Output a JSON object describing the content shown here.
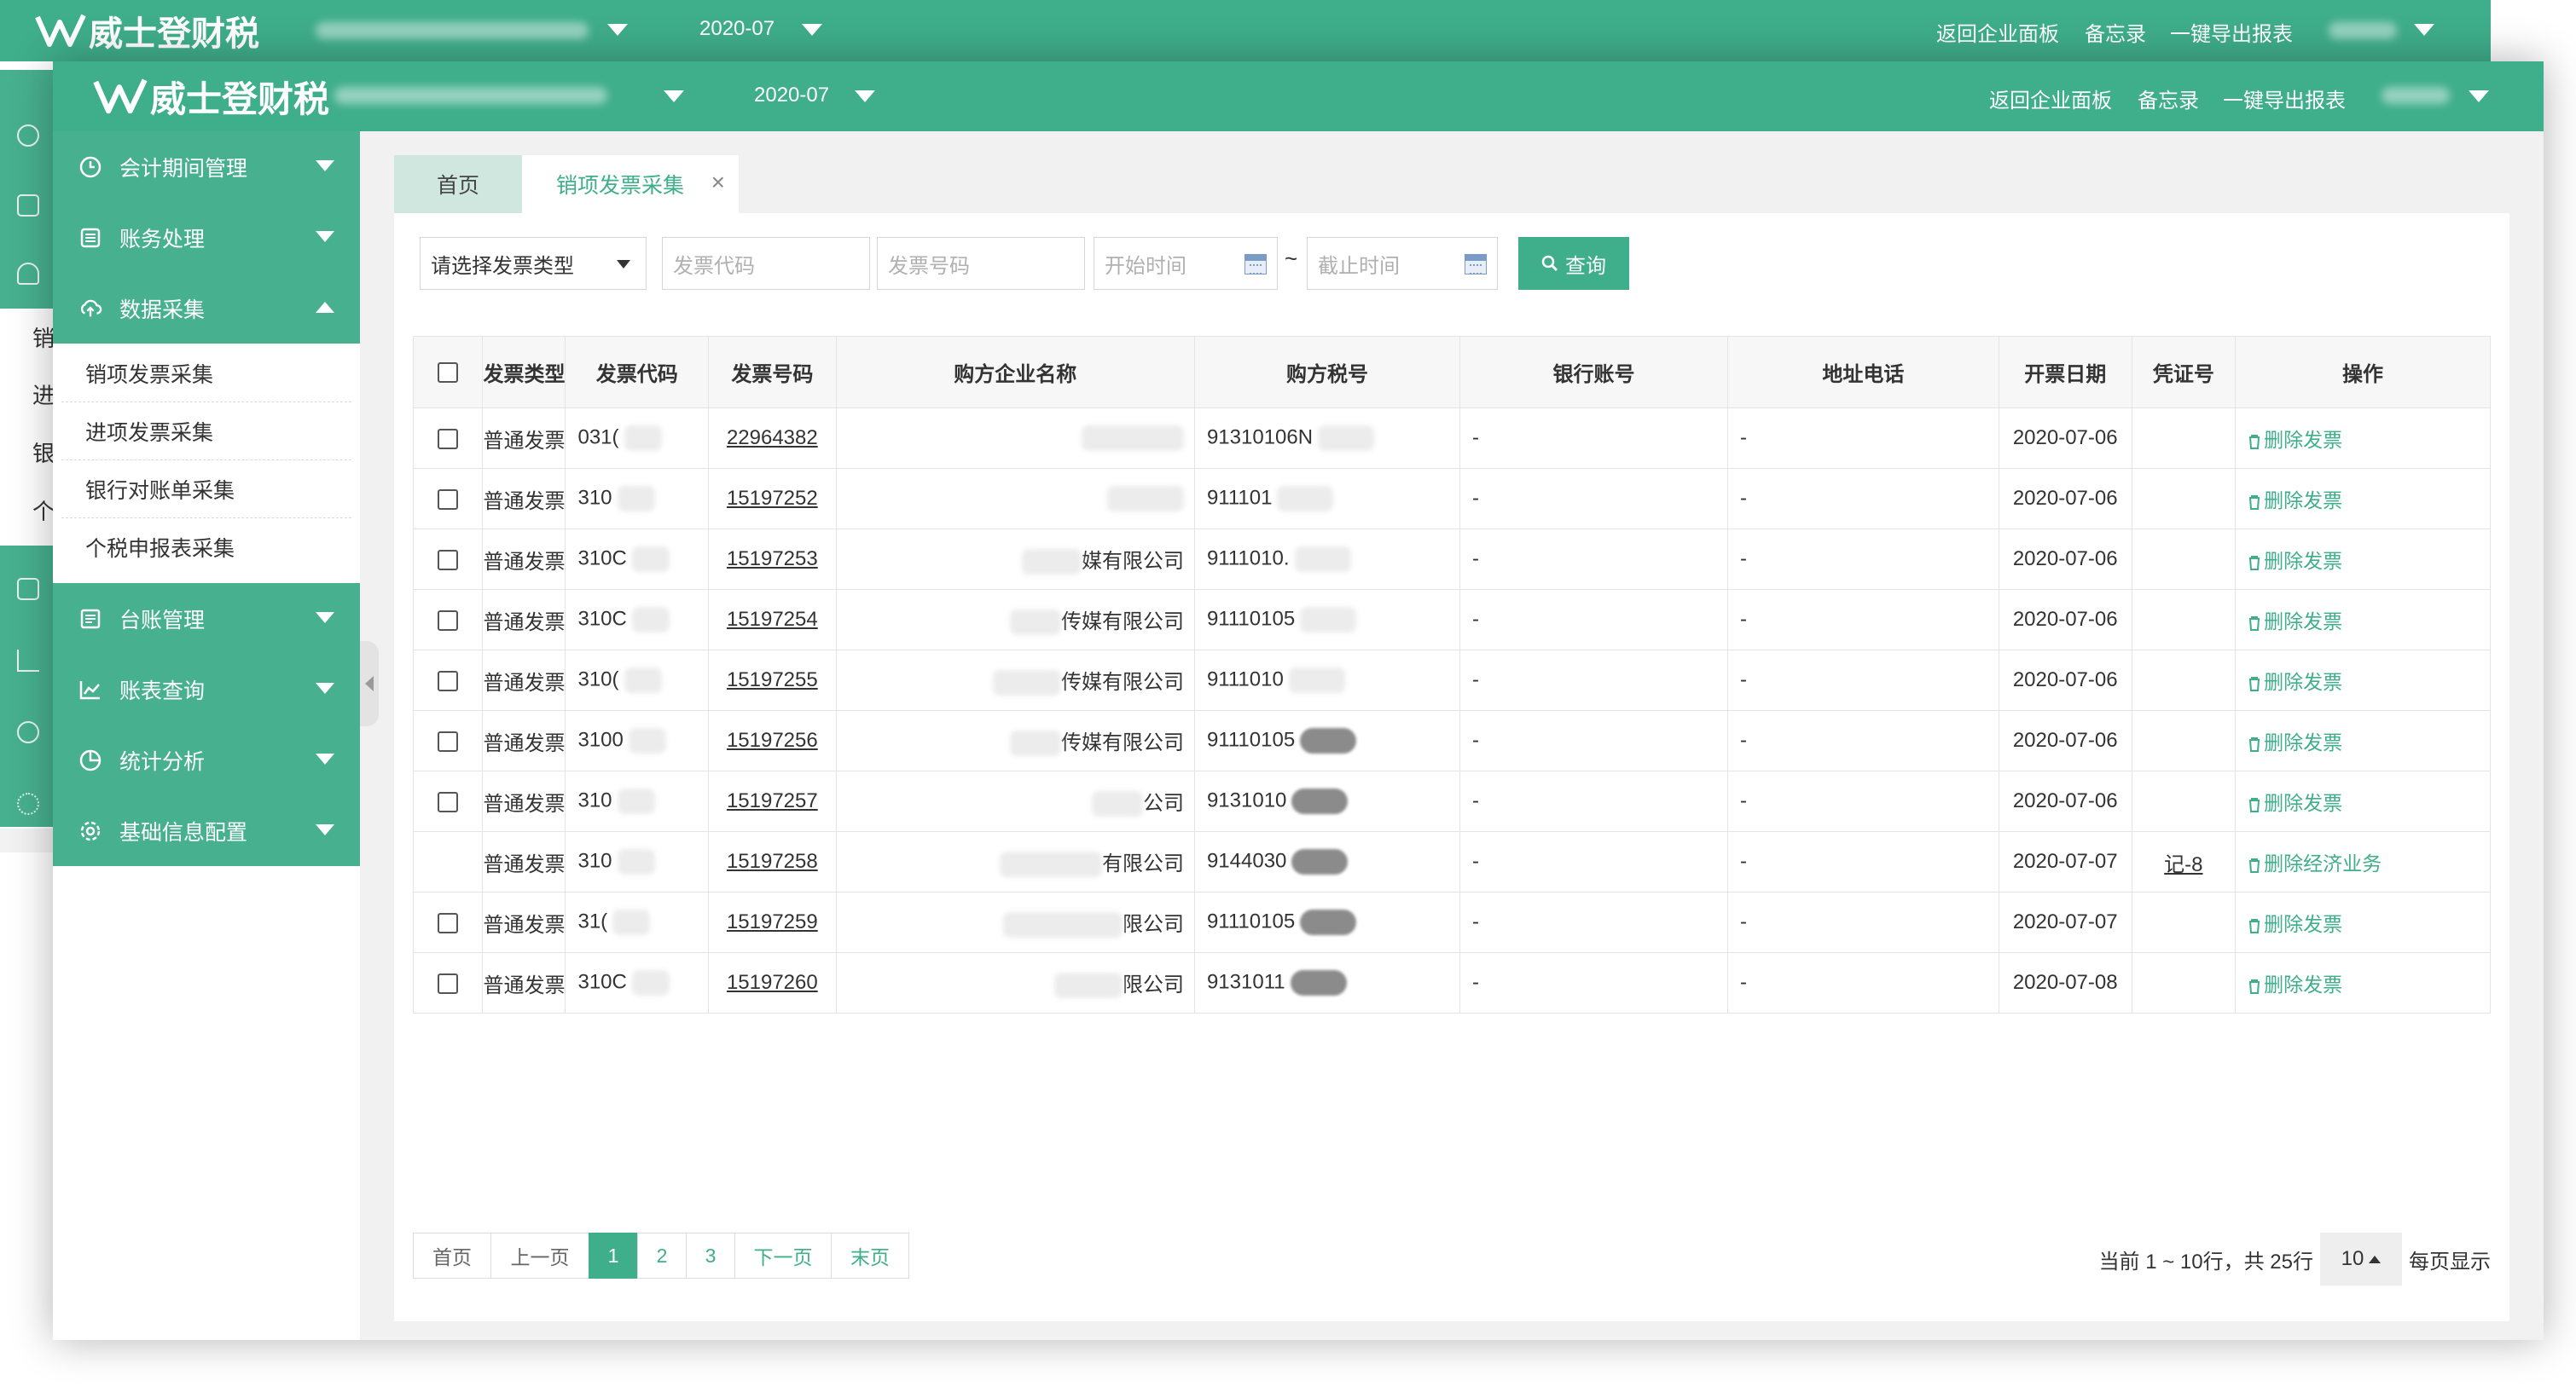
{
  "app": {
    "logo_text": "威士登财税",
    "period": "2020-07",
    "header_links": [
      "返回企业面板",
      "备忘录",
      "一键导出报表"
    ]
  },
  "background_window": {
    "sidebar_chars": [
      "销",
      "进",
      "银",
      "个"
    ]
  },
  "sidebar": {
    "groups": [
      {
        "label": "会计期间管理",
        "icon": "clock-icon",
        "expanded": false
      },
      {
        "label": "账务处理",
        "icon": "ledger-icon",
        "expanded": false
      },
      {
        "label": "数据采集",
        "icon": "cloud-upload-icon",
        "expanded": true
      },
      {
        "label": "台账管理",
        "icon": "list-icon",
        "expanded": false
      },
      {
        "label": "账表查询",
        "icon": "line-chart-icon",
        "expanded": false
      },
      {
        "label": "统计分析",
        "icon": "pie-chart-icon",
        "expanded": false
      },
      {
        "label": "基础信息配置",
        "icon": "gear-icon",
        "expanded": false
      }
    ],
    "sub_items": [
      "销项发票采集",
      "进项发票采集",
      "银行对账单采集",
      "个税申报表采集"
    ]
  },
  "tabs": {
    "home": "首页",
    "current": "销项发票采集",
    "close": "×"
  },
  "filters": {
    "invoice_type": "请选择发票类型",
    "invoice_code_placeholder": "发票代码",
    "invoice_number_placeholder": "发票号码",
    "start_time_placeholder": "开始时间",
    "end_time_placeholder": "截止时间",
    "separator": "~",
    "query_label": "查询"
  },
  "table": {
    "columns": [
      "发票类型",
      "发票代码",
      "发票号码",
      "购方企业名称",
      "购方税号",
      "银行账号",
      "地址电话",
      "开票日期",
      "凭证号",
      "操作"
    ],
    "rows": [
      {
        "type": "普通发票",
        "code": "031(",
        "number": "22964382",
        "buyer": "",
        "tax_id": "91310106N",
        "bank": "-",
        "addr": "-",
        "date": "2020-07-06",
        "voucher": "",
        "action": "删除发票",
        "checkbox": true
      },
      {
        "type": "普通发票",
        "code": "310",
        "number": "15197252",
        "buyer": "",
        "tax_id": "911101",
        "bank": "-",
        "addr": "-",
        "date": "2020-07-06",
        "voucher": "",
        "action": "删除发票",
        "checkbox": true
      },
      {
        "type": "普通发票",
        "code": "310C",
        "number": "15197253",
        "buyer": "媒有限公司",
        "tax_id": "9111010.",
        "bank": "-",
        "addr": "-",
        "date": "2020-07-06",
        "voucher": "",
        "action": "删除发票",
        "checkbox": true
      },
      {
        "type": "普通发票",
        "code": "310C",
        "number": "15197254",
        "buyer": "传媒有限公司",
        "tax_id": "91110105",
        "bank": "-",
        "addr": "-",
        "date": "2020-07-06",
        "voucher": "",
        "action": "删除发票",
        "checkbox": true
      },
      {
        "type": "普通发票",
        "code": "310(",
        "number": "15197255",
        "buyer": "传媒有限公司",
        "tax_id": "9111010",
        "bank": "-",
        "addr": "-",
        "date": "2020-07-06",
        "voucher": "",
        "action": "删除发票",
        "checkbox": true
      },
      {
        "type": "普通发票",
        "code": "3100",
        "number": "15197256",
        "buyer": "传媒有限公司",
        "tax_id": "91110105",
        "bank": "-",
        "addr": "-",
        "date": "2020-07-06",
        "voucher": "",
        "action": "删除发票",
        "checkbox": true
      },
      {
        "type": "普通发票",
        "code": "310",
        "number": "15197257",
        "buyer": "公司",
        "tax_id": "9131010",
        "bank": "-",
        "addr": "-",
        "date": "2020-07-06",
        "voucher": "",
        "action": "删除发票",
        "checkbox": true
      },
      {
        "type": "普通发票",
        "code": "310",
        "number": "15197258",
        "buyer": "有限公司",
        "tax_id": "9144030",
        "bank": "-",
        "addr": "-",
        "date": "2020-07-07",
        "voucher": "记-8",
        "action": "删除经济业务",
        "checkbox": false
      },
      {
        "type": "普通发票",
        "code": "31(",
        "number": "15197259",
        "buyer": "限公司",
        "tax_id": "91110105",
        "bank": "-",
        "addr": "-",
        "date": "2020-07-07",
        "voucher": "",
        "action": "删除发票",
        "checkbox": true
      },
      {
        "type": "普通发票",
        "code": "310C",
        "number": "15197260",
        "buyer": "限公司",
        "tax_id": "9131011",
        "bank": "-",
        "addr": "-",
        "date": "2020-07-08",
        "voucher": "",
        "action": "删除发票",
        "checkbox": true
      }
    ]
  },
  "pagination": {
    "first": "首页",
    "prev": "上一页",
    "pages": [
      "1",
      "2",
      "3"
    ],
    "current_page": "1",
    "next": "下一页",
    "last": "末页",
    "info": "当前 1 ~ 10行，共 25行",
    "page_size": "10",
    "per_page_label": "每页显示"
  },
  "colors": {
    "brand": "#3fae8a",
    "sidebar_green": "#47b08e",
    "active_tab_bg": "#cfe7df"
  }
}
